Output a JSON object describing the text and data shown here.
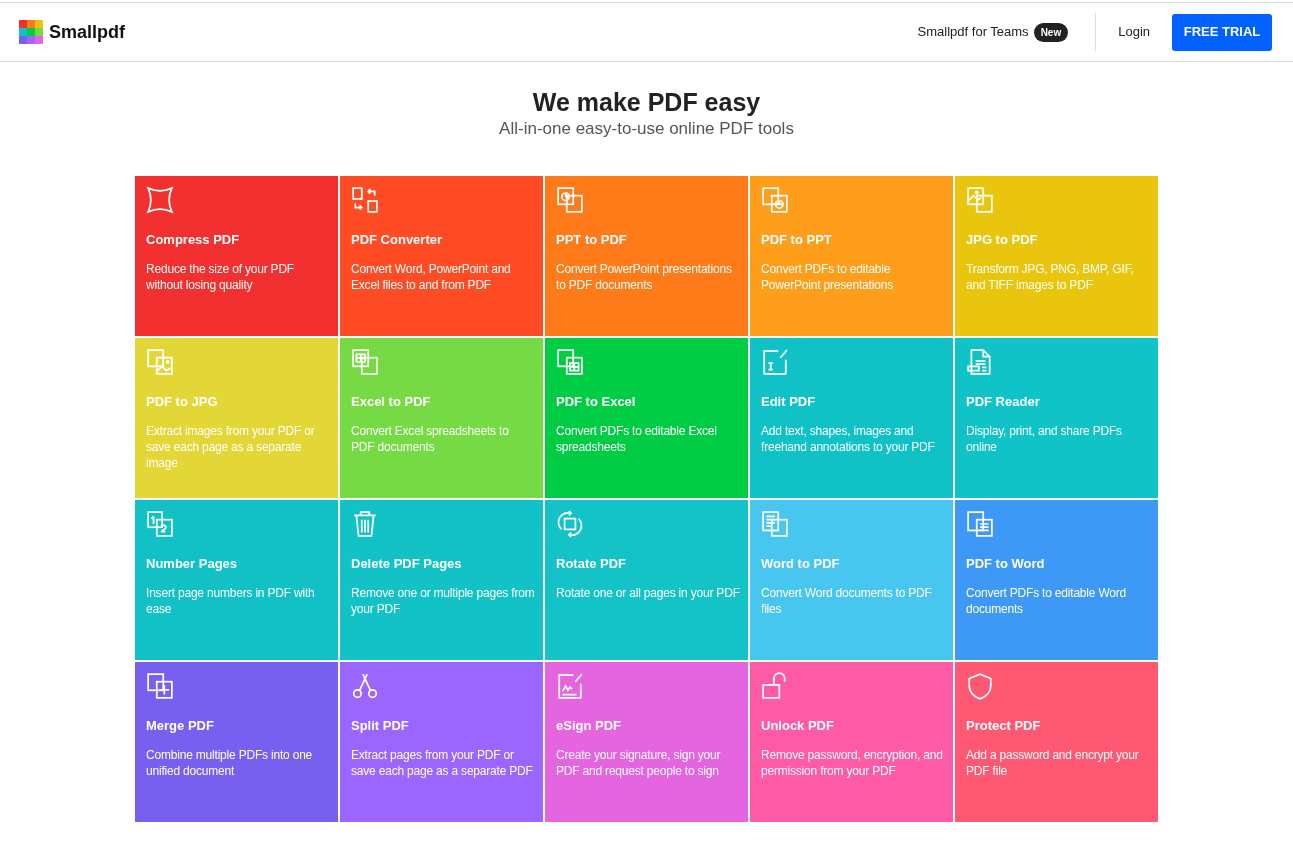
{
  "header": {
    "brand": "Smallpdf",
    "teams_link": "Smallpdf for Teams",
    "teams_badge": "New",
    "login": "Login",
    "cta": "FREE TRIAL"
  },
  "hero": {
    "title": "We make PDF easy",
    "subtitle": "All-in-one easy-to-use online PDF tools"
  },
  "tools": [
    {
      "title": "Compress PDF",
      "description": "Reduce the size of your PDF without losing quality",
      "color": "#f23030"
    },
    {
      "title": "PDF Converter",
      "description": "Convert Word, PowerPoint and Excel files to and from PDF",
      "color": "#ff4c24"
    },
    {
      "title": "PPT to PDF",
      "description": "Convert PowerPoint presentations to PDF documents",
      "color": "#ff7b1a"
    },
    {
      "title": "PDF to PPT",
      "description": "Convert PDFs to editable PowerPoint presentations",
      "color": "#ff9e1b"
    },
    {
      "title": "JPG to PDF",
      "description": "Transform JPG, PNG, BMP, GIF, and TIFF images to PDF",
      "color": "#eac50d"
    },
    {
      "title": "PDF to JPG",
      "description": "Extract images from your PDF or save each page as a separate image",
      "color": "#e3d738"
    },
    {
      "title": "Excel to PDF",
      "description": "Convert Excel spreadsheets to PDF documents",
      "color": "#75da44"
    },
    {
      "title": "PDF to Excel",
      "description": "Convert PDFs to editable Excel spreadsheets",
      "color": "#00cc44"
    },
    {
      "title": "Edit PDF",
      "description": "Add text, shapes, images and freehand annotations to your PDF",
      "color": "#10c2c6"
    },
    {
      "title": "PDF Reader",
      "description": "Display, print, and share PDFs online",
      "color": "#10c3c7"
    },
    {
      "title": "Number Pages",
      "description": "Insert page numbers in PDF with ease",
      "color": "#11c1c5"
    },
    {
      "title": "Delete PDF Pages",
      "description": "Remove one or multiple pages from your PDF",
      "color": "#12c2c6"
    },
    {
      "title": "Rotate PDF",
      "description": "Rotate one or all pages in your PDF",
      "color": "#13c3c7"
    },
    {
      "title": "Word to PDF",
      "description": "Convert Word documents to PDF files",
      "color": "#47c6f0"
    },
    {
      "title": "PDF to Word",
      "description": "Convert PDFs to editable Word documents",
      "color": "#3d99f5"
    },
    {
      "title": "Merge PDF",
      "description": "Combine multiple PDFs into one unified document",
      "color": "#7760f0"
    },
    {
      "title": "Split PDF",
      "description": "Extract pages from your PDF or save each page as a separate PDF",
      "color": "#9b66ff"
    },
    {
      "title": "eSign PDF",
      "description": "Create your signature, sign your PDF and request people to sign",
      "color": "#e565e0"
    },
    {
      "title": "Unlock PDF",
      "description": "Remove password, encryption, and permission from your PDF",
      "color": "#ff5aa6"
    },
    {
      "title": "Protect PDF",
      "description": "Add a password and encrypt your PDF file",
      "color": "#ff5873"
    }
  ]
}
